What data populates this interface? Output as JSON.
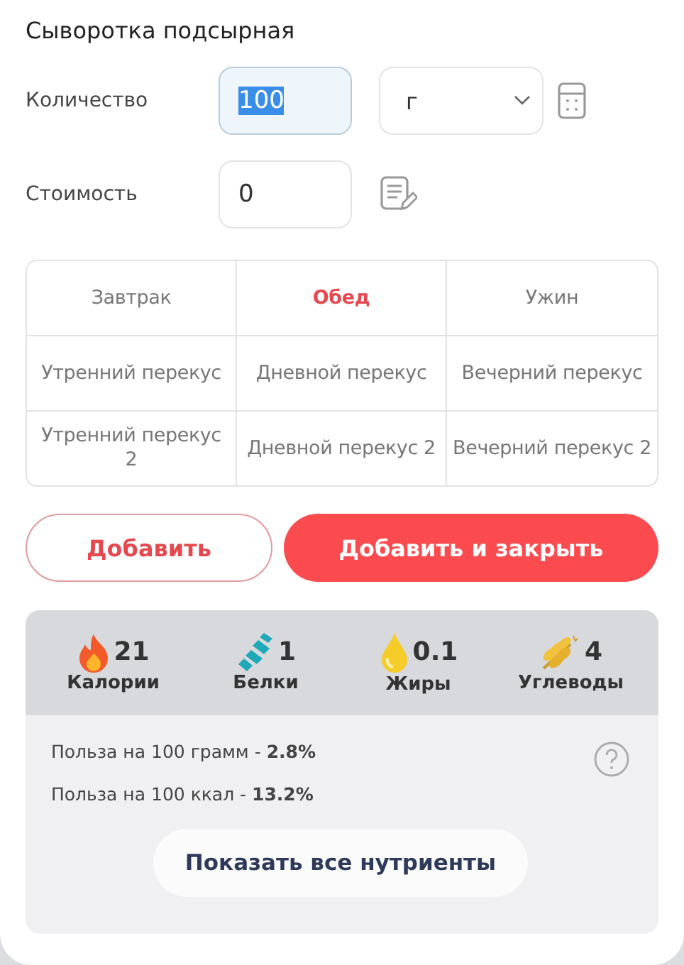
{
  "title": "Сыворотка подсырная",
  "quantity": {
    "label": "Количество",
    "value": "100",
    "text_selected": true,
    "unit": "г"
  },
  "cost": {
    "label": "Стоимость",
    "value": "0"
  },
  "meals": [
    {
      "label": "Завтрак",
      "selected": false
    },
    {
      "label": "Обед",
      "selected": true
    },
    {
      "label": "Ужин",
      "selected": false
    },
    {
      "label": "Утренний перекус",
      "selected": false
    },
    {
      "label": "Дневной перекус",
      "selected": false
    },
    {
      "label": "Вечерний перекус",
      "selected": false
    },
    {
      "label": "Утренний перекус 2",
      "selected": false
    },
    {
      "label": "Дневной перекус 2",
      "selected": false
    },
    {
      "label": "Вечерний перекус 2",
      "selected": false
    }
  ],
  "buttons": [
    {
      "label": "Добавить",
      "kind": "outline"
    },
    {
      "label": "Добавить и закрыть",
      "kind": "filled"
    }
  ],
  "nutrients": [
    {
      "kind": "calories",
      "value": "21",
      "label": "Калории"
    },
    {
      "kind": "protein",
      "value": "1",
      "label": "Белки"
    },
    {
      "kind": "fat",
      "value": "0.1",
      "label": "Жиры"
    },
    {
      "kind": "carbs",
      "value": "4",
      "label": "Углеводы"
    }
  ],
  "benefits": [
    "Польза на 100 грамм - **2.8%**",
    "Польза на 100 ккал - **13.2%**"
  ],
  "show_all_button": "Показать все нутриенты"
}
